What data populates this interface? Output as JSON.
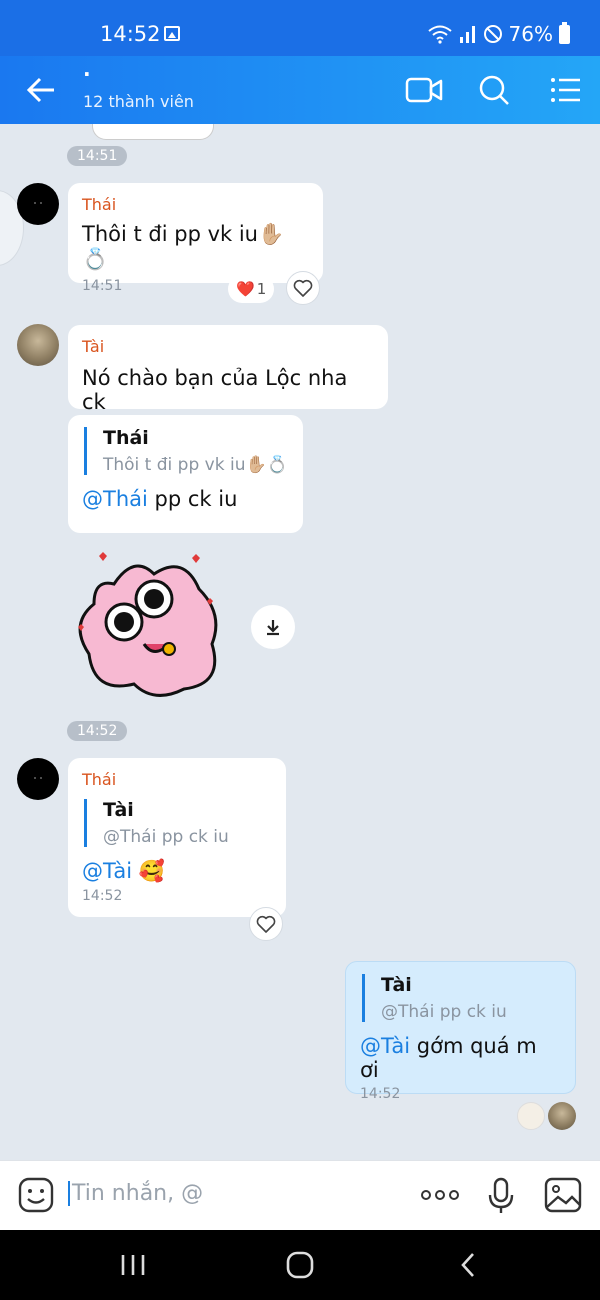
{
  "status_bar": {
    "time": "14:52",
    "battery": "76%"
  },
  "header": {
    "title": "·",
    "subtitle": "12 thành viên"
  },
  "messages": [
    {
      "time_pill": "14:51"
    },
    {
      "sender": "Thái",
      "text": "Thôi t đi pp vk iu✋🏼💍",
      "time": "14:51",
      "reaction": "❤️",
      "reaction_count": "1"
    },
    {
      "sender": "Tài",
      "text": "Nó chào bạn của Lộc nha ck"
    },
    {
      "quote_name": "Thái",
      "quote_text": "Thôi t đi pp vk iu✋🏼💍",
      "mention": "@Thái",
      "text": " pp ck iu"
    },
    {
      "time_pill": "14:52"
    },
    {
      "sender": "Thái",
      "quote_name": "Tài",
      "quote_text": "@Thái pp ck iu",
      "mention": "@Tài",
      "text": " 🥰",
      "time": "14:52"
    },
    {
      "quote_name": "Tài",
      "quote_text": "@Thái pp ck iu",
      "mention": "@Tài",
      "text": " gớm quá m ơi",
      "time": "14:52"
    }
  ],
  "input": {
    "placeholder": "Tin nhắn, @"
  },
  "colors": {
    "header": "#1e90ff",
    "mention": "#1a7fe0",
    "sender": "#d9541e",
    "sent_bubble": "#d5ecfd"
  }
}
